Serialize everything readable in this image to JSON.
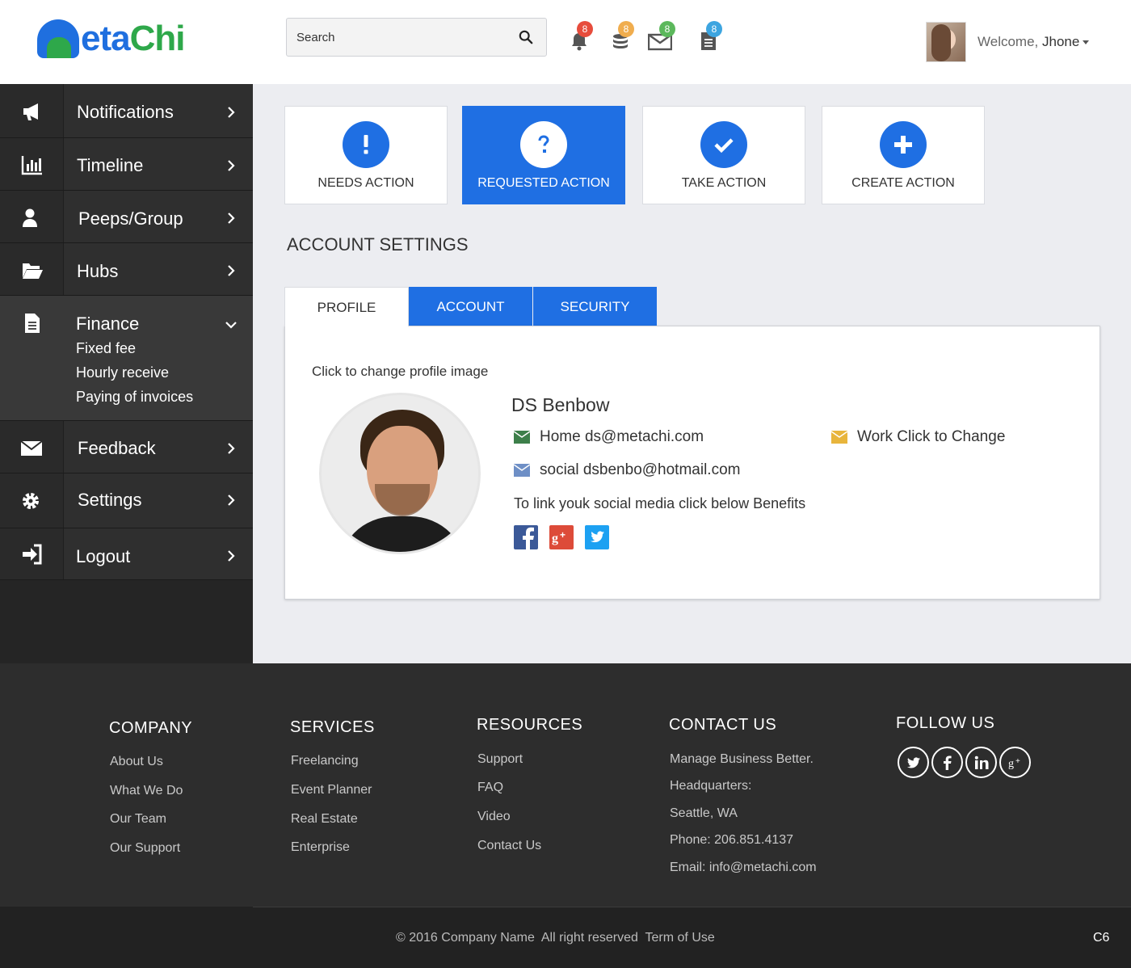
{
  "brand": {
    "logo_left": "m",
    "logo_mid": "eta",
    "logo_right": "Chi"
  },
  "header": {
    "search_placeholder": "Search",
    "badges": [
      {
        "icon": "bell-icon",
        "count": "8",
        "color": "#e74c3c"
      },
      {
        "icon": "coins-icon",
        "count": "8",
        "color": "#f0ad4e"
      },
      {
        "icon": "envelope-icon",
        "count": "8",
        "color": "#5cb85c"
      },
      {
        "icon": "document-icon",
        "count": "8",
        "color": "#3da5e0"
      }
    ],
    "welcome": "Welcome,",
    "username": "Jhone"
  },
  "sidebar": {
    "items": [
      {
        "label": "Notifications",
        "icon": "megaphone-icon"
      },
      {
        "label": "Timeline",
        "icon": "bar-chart-icon"
      },
      {
        "label": "Peeps/Group",
        "icon": "user-icon"
      },
      {
        "label": "Hubs",
        "icon": "folder-open-icon"
      },
      {
        "label": "Finance",
        "icon": "file-icon",
        "expanded": true,
        "children": [
          "Fixed fee",
          "Hourly receive",
          "Paying of invoices"
        ]
      },
      {
        "label": "Feedback",
        "icon": "envelope-icon"
      },
      {
        "label": "Settings",
        "icon": "gear-icon"
      },
      {
        "label": "Logout",
        "icon": "sign-in-icon"
      }
    ]
  },
  "actions": [
    {
      "label": "NEEDS ACTION",
      "icon": "exclamation-icon",
      "active": false
    },
    {
      "label": "REQUESTED ACTION",
      "icon": "question-icon",
      "active": true
    },
    {
      "label": "TAKE ACTION",
      "icon": "check-icon",
      "active": false
    },
    {
      "label": "CREATE ACTION",
      "icon": "plus-icon",
      "active": false
    }
  ],
  "settings": {
    "title": "ACCOUNT SETTINGS",
    "tabs": [
      "PROFILE",
      "ACCOUNT",
      "SECURITY"
    ],
    "active_tab": "PROFILE",
    "change_image": "Click to change profile image",
    "name": "DS Benbow",
    "home_email": "Home ds@metachi.com",
    "work_email": "Work Click to Change",
    "social_email": "social dsbenbo@hotmail.com",
    "social_prompt": "To link youk social media click below Benefits",
    "social_links": [
      "facebook-icon",
      "google-plus-icon",
      "twitter-icon"
    ]
  },
  "footer": {
    "company": {
      "title": "COMPANY",
      "links": [
        "About Us",
        "What We Do",
        "Our Team",
        "Our Support"
      ]
    },
    "services": {
      "title": "SERVICES",
      "links": [
        "Freelancing",
        "Event Planner",
        "Real Estate",
        "Enterprise"
      ]
    },
    "resources": {
      "title": "RESOURCES",
      "links": [
        "Support",
        "FAQ",
        "Video",
        "Contact Us"
      ]
    },
    "contact": {
      "title": "CONTACT US",
      "lines": [
        "Manage Business Better.",
        "Headquarters:",
        "Seattle, WA",
        "Phone: 206.851.4137",
        "Email: info@metachi.com"
      ]
    },
    "follow": {
      "title": "FOLLOW US",
      "icons": [
        "twitter-icon",
        "facebook-icon",
        "linkedin-icon",
        "google-plus-icon"
      ]
    },
    "copyright": "© 2016 Company Name  All right reserved  Term of Use",
    "code": "C6"
  },
  "colors": {
    "accent": "#1f6fe3",
    "green": "#2ea84a",
    "sidebar": "#2f2f2f",
    "footer": "#2d2d2d"
  }
}
